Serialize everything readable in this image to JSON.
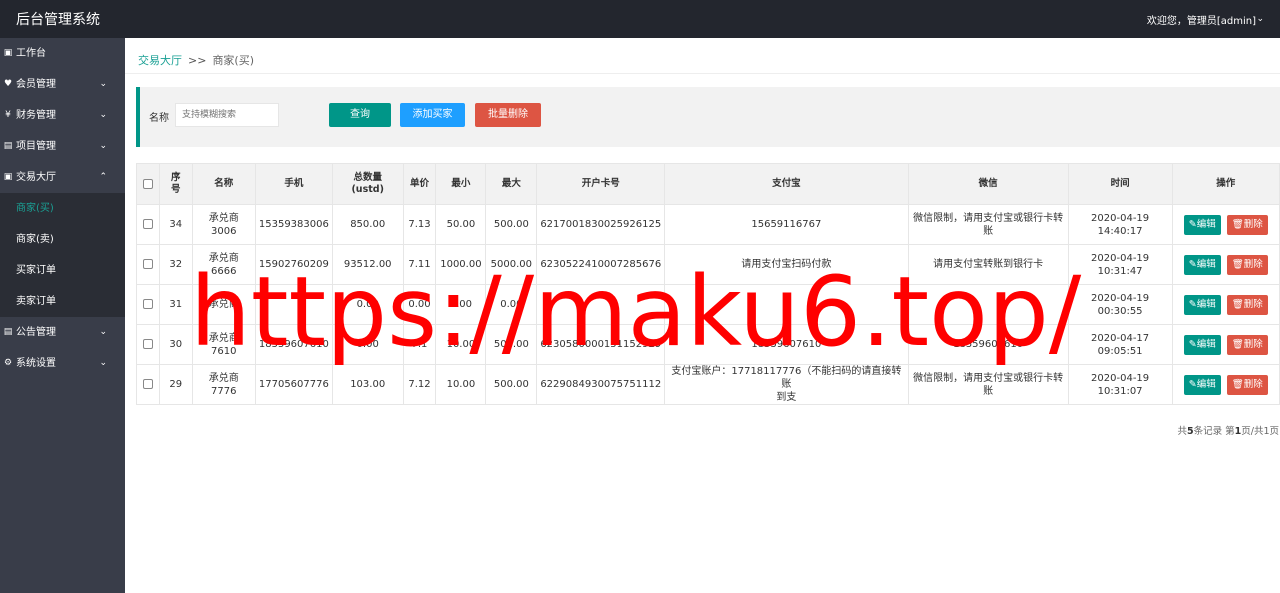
{
  "topbar": {
    "title": "后台管理系统",
    "user": "欢迎您，管理员[admin]"
  },
  "sidebar": {
    "items": [
      {
        "label": "工作台",
        "icon": "▣",
        "chev": ""
      },
      {
        "label": "会员管理",
        "icon": "♥",
        "chev": "⌄"
      },
      {
        "label": "财务管理",
        "icon": "¥",
        "chev": "⌄"
      },
      {
        "label": "项目管理",
        "icon": "▤",
        "chev": "⌄"
      },
      {
        "label": "交易大厅",
        "icon": "▣",
        "chev": "⌃"
      }
    ],
    "subitems": [
      "商家(买)",
      "商家(卖)",
      "买家订单",
      "卖家订单"
    ],
    "items2": [
      {
        "label": "公告管理",
        "icon": "▤",
        "chev": "⌄"
      },
      {
        "label": "系统设置",
        "icon": "⚙",
        "chev": "⌄"
      }
    ]
  },
  "breadcrumb": {
    "parent": "交易大厅",
    "sep": ">>",
    "current": "商家(买)"
  },
  "search": {
    "label": "名称",
    "placeholder": "支持模糊搜索",
    "query_btn": "查询",
    "add_btn": "添加买家",
    "batch_delete_btn": "批量删除"
  },
  "table": {
    "headers": [
      "序\n号",
      "名称",
      "手机",
      "总数量\n(ustd)",
      "单价",
      "最小",
      "最大",
      "开户卡号",
      "支付宝",
      "微信",
      "时间",
      "操作"
    ],
    "edit_label": "编辑",
    "delete_label": "删除",
    "rows": [
      {
        "id": "34",
        "name": "承兑商\n3006",
        "phone": "15359383006",
        "total": "850.00",
        "price": "7.13",
        "min": "50.00",
        "max": "500.00",
        "card": "6217001830025926125",
        "alipay": "15659116767",
        "wechat": "微信限制，请用支付宝或银行卡转\n账",
        "time": "2020-04-19\n14:40:17"
      },
      {
        "id": "32",
        "name": "承兑商\n6666",
        "phone": "15902760209",
        "total": "93512.00",
        "price": "7.11",
        "min": "1000.00",
        "max": "5000.00",
        "card": "6230522410007285676",
        "alipay": "请用支付宝扫码付款",
        "wechat": "请用支付宝转账到银行卡",
        "time": "2020-04-19\n10:31:47"
      },
      {
        "id": "31",
        "name": "承兑商",
        "phone": "",
        "total": "0.00",
        "price": "0.00",
        "min": "0.00",
        "max": "0.00",
        "card": "",
        "alipay": "",
        "wechat": "",
        "time": "2020-04-19\n00:30:55"
      },
      {
        "id": "30",
        "name": "承兑商\n7610",
        "phone": "18559607610",
        "total": "0.00",
        "price": "7.1",
        "min": "10.00",
        "max": "500.00",
        "card": "6230580000151152929",
        "alipay": "18559607610",
        "wechat": "18559607610",
        "time": "2020-04-17\n09:05:51"
      },
      {
        "id": "29",
        "name": "承兑商\n7776",
        "phone": "17705607776",
        "total": "103.00",
        "price": "7.12",
        "min": "10.00",
        "max": "500.00",
        "card": "6229084930075751112",
        "alipay": "支付宝账户：17718117776（不能扫码的请直接转账\n到支",
        "wechat": "微信限制，请用支付宝或银行卡转\n账",
        "time": "2020-04-19\n10:31:07"
      }
    ]
  },
  "pager": {
    "prefix": "共",
    "count": "5",
    "mid": "条记录 第",
    "page": "1",
    "suffix": "页/共1页"
  },
  "watermark": "https://maku6.top/"
}
